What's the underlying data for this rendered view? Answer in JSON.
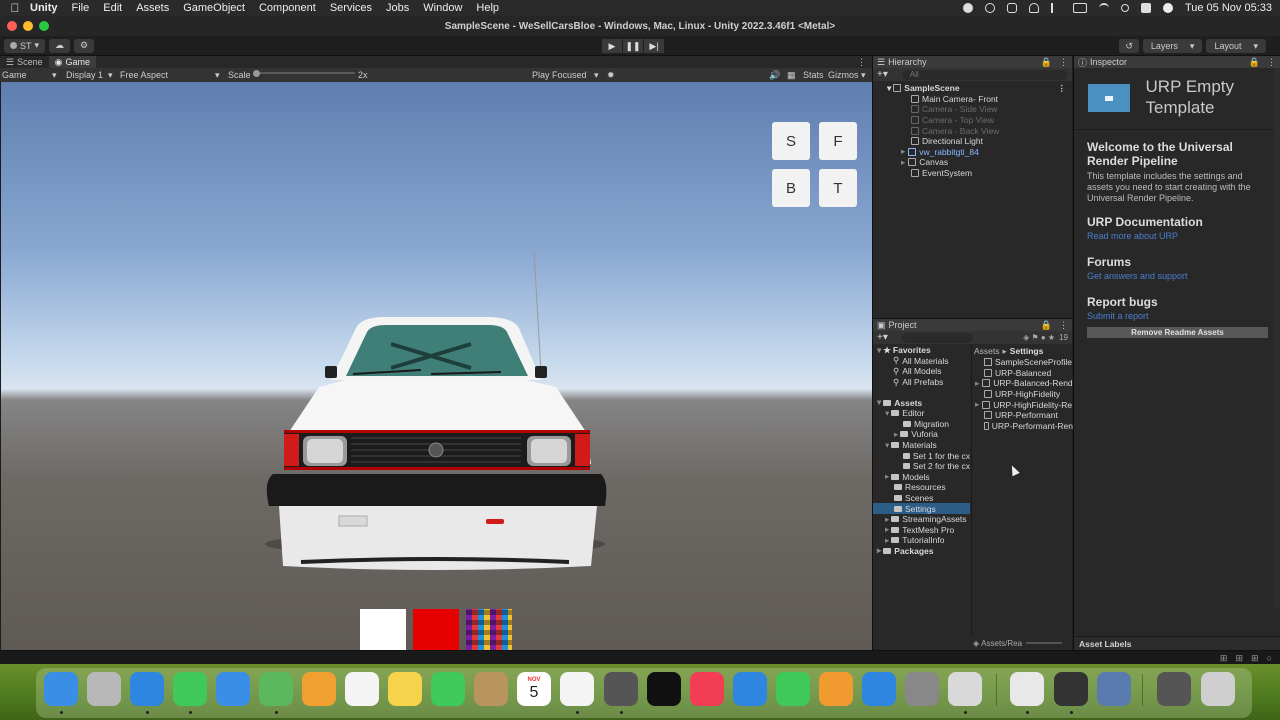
{
  "menubar": {
    "app_name": "Unity",
    "items": [
      "File",
      "Edit",
      "Assets",
      "GameObject",
      "Component",
      "Services",
      "Jobs",
      "Window",
      "Help"
    ],
    "clock": "Tue 05 Nov  05:33"
  },
  "window": {
    "title": "SampleScene - WeSellCarsBloe - Windows, Mac, Linux - Unity 2022.3.46f1 <Metal>"
  },
  "toolbar": {
    "account_label": "ST",
    "layers_label": "Layers",
    "layout_label": "Layout"
  },
  "game_panel": {
    "tabs": [
      {
        "label": "Scene"
      },
      {
        "label": "Game"
      }
    ],
    "view_mode": "Game",
    "display": "Display 1",
    "aspect": "Free Aspect",
    "scale_label": "Scale",
    "scale_value": "2x",
    "play_focused": "Play Focused",
    "stats_label": "Stats",
    "gizmos_label": "Gizmos",
    "overlay_buttons": [
      "S",
      "F",
      "B",
      "T"
    ],
    "swatch_colors": [
      "#ffffff",
      "#e60000"
    ]
  },
  "hierarchy": {
    "title": "Hierarchy",
    "search_placeholder": "All",
    "scene_name": "SampleScene",
    "items": [
      {
        "label": "Main Camera- Front",
        "style": "normal"
      },
      {
        "label": "Camera - Side View",
        "style": "dim"
      },
      {
        "label": "Camera - Top View",
        "style": "dim"
      },
      {
        "label": "Camera - Back View",
        "style": "dim"
      },
      {
        "label": "Directional Light",
        "style": "normal"
      },
      {
        "label": "vw_rabbitgti_84",
        "style": "blue"
      },
      {
        "label": "Canvas",
        "style": "normal"
      },
      {
        "label": "EventSystem",
        "style": "normal"
      }
    ]
  },
  "project": {
    "title": "Project",
    "count": "19",
    "favorites_label": "Favorites",
    "favorites": [
      "All Materials",
      "All Models",
      "All Prefabs"
    ],
    "assets_label": "Assets",
    "tree": [
      {
        "label": "Editor",
        "depth": 1
      },
      {
        "label": "Migration",
        "depth": 2
      },
      {
        "label": "Vuforia",
        "depth": 2
      },
      {
        "label": "Materials",
        "depth": 1
      },
      {
        "label": "Set 1 for the cx",
        "depth": 2
      },
      {
        "label": "Set 2 for the cx",
        "depth": 2
      },
      {
        "label": "Models",
        "depth": 1
      },
      {
        "label": "Resources",
        "depth": 1
      },
      {
        "label": "Scenes",
        "depth": 1
      },
      {
        "label": "Settings",
        "depth": 1,
        "selected": true
      },
      {
        "label": "StreamingAssets",
        "depth": 1
      },
      {
        "label": "TextMesh Pro",
        "depth": 1
      },
      {
        "label": "TutorialInfo",
        "depth": 1
      }
    ],
    "packages_label": "Packages",
    "breadcrumb_root": "Assets",
    "breadcrumb_current": "Settings",
    "files": [
      "SampleSceneProfile",
      "URP-Balanced",
      "URP-Balanced-Rend",
      "URP-HighFidelity",
      "URP-HighFidelity-Re",
      "URP-Performant",
      "URP-Performant-Ren"
    ],
    "footer_path": "Assets/Rea"
  },
  "inspector": {
    "title": "Inspector",
    "header_title": "URP Empty Template",
    "welcome_heading": "Welcome to the Universal Render Pipeline",
    "welcome_text": "This template includes the settings and assets you need to start creating with the Universal Render Pipeline.",
    "docs_heading": "URP Documentation",
    "docs_link": "Read more about URP",
    "forums_heading": "Forums",
    "forums_link": "Get answers and support",
    "bugs_heading": "Report bugs",
    "bugs_link": "Submit a report",
    "remove_button": "Remove Readme Assets",
    "footer_label": "Asset Labels"
  },
  "dock": {
    "calendar_month": "NOV",
    "calendar_day": "5",
    "apps": [
      {
        "name": "finder-icon",
        "color": "#3a8ee6"
      },
      {
        "name": "launchpad-icon",
        "color": "#b8b8b8"
      },
      {
        "name": "safari-icon",
        "color": "#2e86e0"
      },
      {
        "name": "messages-icon",
        "color": "#3ec95a"
      },
      {
        "name": "mail-icon",
        "color": "#3a8ee6"
      },
      {
        "name": "maps-icon",
        "color": "#5cb85c"
      },
      {
        "name": "photos-icon",
        "color": "#f0a030"
      },
      {
        "name": "reminders-icon",
        "color": "#f4f4f4"
      },
      {
        "name": "notes-icon",
        "color": "#f7d24b"
      },
      {
        "name": "facetime-icon",
        "color": "#3ec95a"
      },
      {
        "name": "contacts-icon",
        "color": "#b8945e"
      },
      {
        "name": "calendar-icon",
        "color": "#ffffff"
      },
      {
        "name": "freeform-icon",
        "color": "#f4f4f4"
      },
      {
        "name": "unity-hub-icon",
        "color": "#555555"
      },
      {
        "name": "appletv-icon",
        "color": "#111111"
      },
      {
        "name": "music-icon",
        "color": "#f23d55"
      },
      {
        "name": "keynote-icon",
        "color": "#2e86e0"
      },
      {
        "name": "numbers-icon",
        "color": "#3ec95a"
      },
      {
        "name": "pages-icon",
        "color": "#f09a30"
      },
      {
        "name": "appstore-icon",
        "color": "#2e86e0"
      },
      {
        "name": "system-settings-icon",
        "color": "#888888"
      },
      {
        "name": "iphone-mirroring-icon",
        "color": "#d9d9d9"
      },
      {
        "name": "chrome-icon",
        "color": "#e8e8e8"
      },
      {
        "name": "unity-icon",
        "color": "#333333"
      },
      {
        "name": "quicktime-icon",
        "color": "#5a7bb0"
      },
      {
        "name": "downloads-stack-icon",
        "color": "#555555"
      },
      {
        "name": "trash-icon",
        "color": "#cfcfcf"
      }
    ]
  }
}
